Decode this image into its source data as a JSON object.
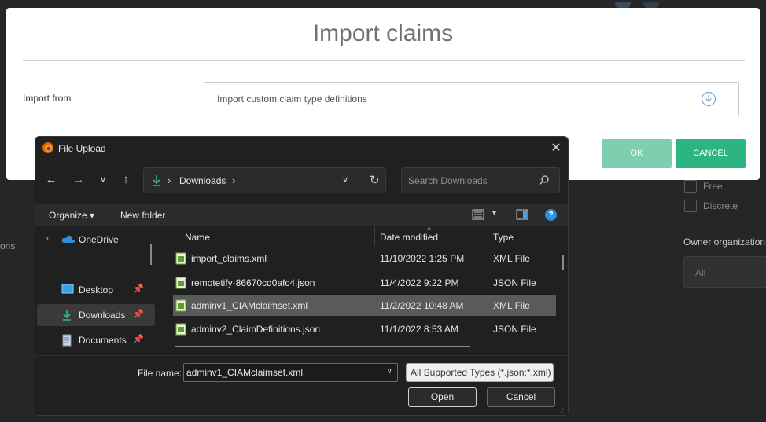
{
  "modal": {
    "title": "Import claims",
    "import_label": "Import from",
    "import_select_value": "Import custom claim type definitions",
    "ok_label": "OK",
    "cancel_label": "CANCEL"
  },
  "background": {
    "free_label": "Free",
    "discrete_label": "Discrete",
    "owner_org_label": "Owner organization",
    "owner_org_value": "All",
    "left_fragment": "ons"
  },
  "dialog": {
    "title": "File Upload",
    "address_crumb": "Downloads",
    "search_placeholder": "Search Downloads",
    "organize_label": "Organize",
    "new_folder_label": "New folder",
    "nav_items": [
      {
        "label": "OneDrive",
        "icon": "cloud-icon"
      },
      {
        "label": "Desktop",
        "icon": "desktop-icon"
      },
      {
        "label": "Downloads",
        "icon": "download-icon"
      },
      {
        "label": "Documents",
        "icon": "documents-icon"
      }
    ],
    "columns": {
      "name": "Name",
      "date": "Date modified",
      "type": "Type"
    },
    "files": [
      {
        "name": "import_claims.xml",
        "date": "11/10/2022 1:25 PM",
        "type": "XML File"
      },
      {
        "name": "remotetify-86670cd0afc4.json",
        "date": "11/4/2022 9:22 PM",
        "type": "JSON File"
      },
      {
        "name": "adminv1_CIAMclaimset.xml",
        "date": "11/2/2022 10:48 AM",
        "type": "XML File"
      },
      {
        "name": "adminv2_ClaimDefinitions.json",
        "date": "11/1/2022 8:53 AM",
        "type": "JSON File"
      }
    ],
    "file_name_label": "File name:",
    "file_name_value": "adminv1_CIAMclaimset.xml",
    "file_type_value": "All Supported Types (*.json;*.xml)",
    "open_label": "Open",
    "cancel_label": "Cancel",
    "help_glyph": "?"
  },
  "colors": {
    "ok_button": "#7dcfb0",
    "cancel_button": "#2ab581",
    "dialog_bg": "#202020",
    "selected_row": "#5a5a5a"
  }
}
